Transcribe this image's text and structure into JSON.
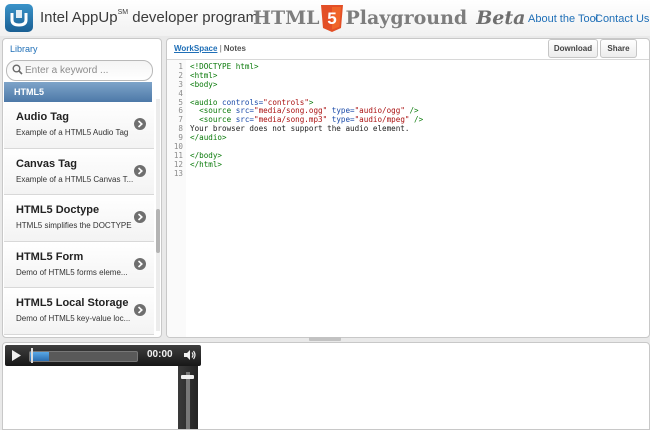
{
  "header": {
    "brand": "Intel AppUp",
    "brand_tm": "SM",
    "brand_suffix": "developer program",
    "title_pre": "HTML",
    "shield_number": "5",
    "title_post": "Playground",
    "title_beta": "Beta",
    "nav": [
      {
        "label": "About the Tool"
      },
      {
        "label": "Contact Us"
      }
    ]
  },
  "library": {
    "title": "Library",
    "search_placeholder": "Enter a keyword ...",
    "category": "HTML5",
    "items": [
      {
        "title": "Audio Tag",
        "desc": "Example of a HTML5 Audio Tag"
      },
      {
        "title": "Canvas Tag",
        "desc": "Example of a HTML5 Canvas T..."
      },
      {
        "title": "HTML5 Doctype",
        "desc": "HTML5 simplifies the DOCTYPE"
      },
      {
        "title": "HTML5 Form",
        "desc": "Demo of HTML5 forms eleme..."
      },
      {
        "title": "HTML5 Local Storage",
        "desc": "Demo of HTML5 key-value loc..."
      }
    ]
  },
  "workspace": {
    "tab_active": "WorkSpace",
    "tab_other": "Notes",
    "download_label": "Download",
    "share_label": "Share",
    "code_lines": [
      {
        "n": "1",
        "parts": [
          {
            "c": "tag",
            "t": "<!DOCTYPE html>"
          }
        ]
      },
      {
        "n": "2",
        "parts": [
          {
            "c": "tag",
            "t": "<html>"
          }
        ]
      },
      {
        "n": "3",
        "parts": [
          {
            "c": "tag",
            "t": "<body>"
          }
        ]
      },
      {
        "n": "4",
        "parts": []
      },
      {
        "n": "5",
        "parts": [
          {
            "c": "tag",
            "t": "<audio "
          },
          {
            "c": "attr",
            "t": "controls="
          },
          {
            "c": "str",
            "t": "\"controls\""
          },
          {
            "c": "tag",
            "t": ">"
          }
        ]
      },
      {
        "n": "6",
        "parts": [
          {
            "c": "tag",
            "t": "  <source "
          },
          {
            "c": "attr",
            "t": "src="
          },
          {
            "c": "str",
            "t": "\"media/song.ogg\""
          },
          {
            "c": "attr",
            "t": " type="
          },
          {
            "c": "str",
            "t": "\"audio/ogg\""
          },
          {
            "c": "tag",
            "t": " />"
          }
        ]
      },
      {
        "n": "7",
        "parts": [
          {
            "c": "tag",
            "t": "  <source "
          },
          {
            "c": "attr",
            "t": "src="
          },
          {
            "c": "str",
            "t": "\"media/song.mp3\""
          },
          {
            "c": "attr",
            "t": " type="
          },
          {
            "c": "str",
            "t": "\"audio/mpeg\""
          },
          {
            "c": "tag",
            "t": " />"
          }
        ]
      },
      {
        "n": "8",
        "parts": [
          {
            "c": "txt",
            "t": "Your browser does not support the audio element."
          }
        ]
      },
      {
        "n": "9",
        "parts": [
          {
            "c": "tag",
            "t": "</audio>"
          }
        ]
      },
      {
        "n": "10",
        "parts": []
      },
      {
        "n": "11",
        "parts": [
          {
            "c": "tag",
            "t": "</body>"
          }
        ]
      },
      {
        "n": "12",
        "parts": [
          {
            "c": "tag",
            "t": "</html>"
          }
        ]
      },
      {
        "n": "13",
        "parts": []
      }
    ]
  },
  "preview": {
    "time": "00:00",
    "progress": 0.18,
    "volume": 0.95
  },
  "colors": {
    "link": "#1f6fb7",
    "html5_orange": "#e34f26",
    "category_bar": "#5b84b1"
  }
}
